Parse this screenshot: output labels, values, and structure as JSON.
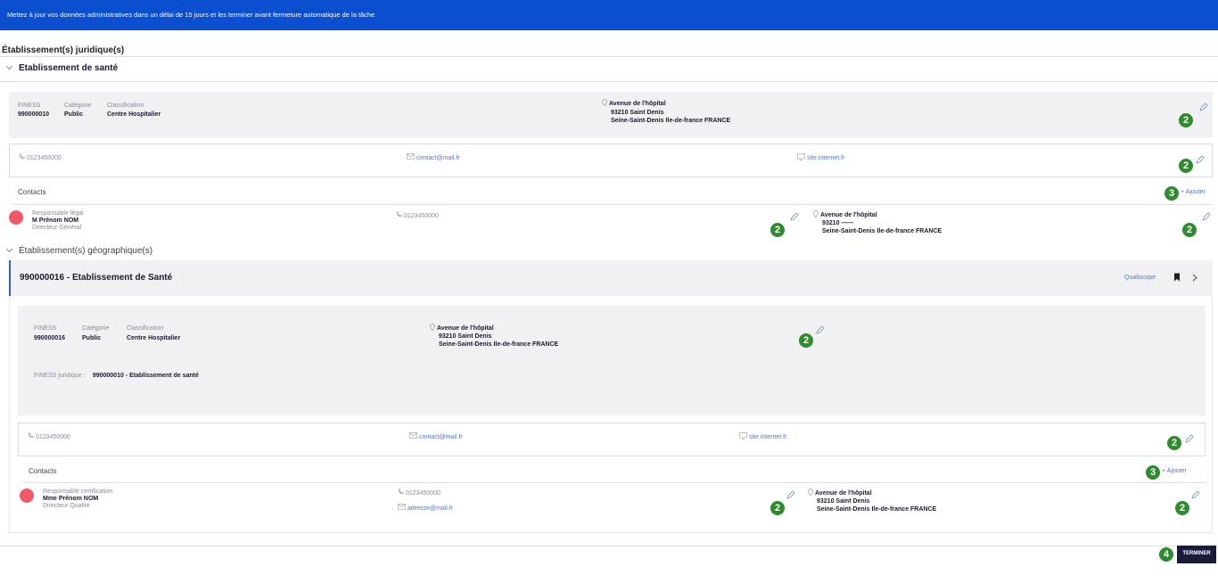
{
  "banner": {
    "text": "Mettez à jour vos données administratives dans un délai de 15 jours et les terminer avant fermeture automatique de la tâche"
  },
  "legal": {
    "title": "Établissement(s) juridique(s)",
    "subtitle": "Etablissement de santé",
    "finess_label": "FINESS",
    "finess": "990000010",
    "categorie_label": "Catégorie",
    "categorie": "Public",
    "classification_label": "Classification",
    "classification": "Centre Hospitalier",
    "addr1": "Avenue de l'hôpital",
    "addr2": "93210  Saint Denis",
    "addr3": "Seine-Saint-Denis  Ile-de-france  FRANCE",
    "phone": "0123450000",
    "email": "contact@mail.fr",
    "website": "site.internet.fr",
    "contacts_label": "Contacts",
    "add_label": "+ Ajouter",
    "contact": {
      "role": "Responsable légal",
      "name": "M  Prénom  NOM",
      "title": "Directeur Général",
      "phone": "0123450000",
      "addr1": "Avenue de l'hôpital",
      "addr2": "93210  ——",
      "addr3": "Seine-Saint-Denis  Ile-de-france  FRANCE"
    }
  },
  "geo": {
    "title": "Établissement(s) géographique(s)",
    "name": "990000016 - Etablissement de Santé",
    "qualiscope": "Qualiscope",
    "finess_label": "FINESS",
    "finess": "990000016",
    "categorie_label": "Catégorie",
    "categorie": "Public",
    "classification_label": "Classification",
    "classification": "Centre Hospitalier",
    "addr1": "Avenue de l'hôpital",
    "addr2": "93210  Saint Denis",
    "addr3": "Seine-Saint-Denis  Ile-de-france  FRANCE",
    "finess_juridique_label": "FINESS juridique :",
    "finess_juridique": "990000010 - Etablissement de santé",
    "phone": "0123450000",
    "email": "contact@mail.fr",
    "website": "site.internet.fr",
    "contacts_label": "Contacts",
    "add_label": "+ Ajouter",
    "contact": {
      "role": "Responsable certification",
      "name": "Mme  Prénom  NOM",
      "title": "Directeur Qualité",
      "phone": "0123450000",
      "email": "adresse@mail.fr",
      "addr1": "Avenue de l'hôpital",
      "addr2": "93210  Saint Denis",
      "addr3": "Seine-Saint-Denis  Ile-de-france  FRANCE"
    }
  },
  "badges": {
    "edit": "2",
    "add": "3",
    "finish": "4"
  },
  "terminer_label": "TERMINER",
  "colors": {
    "banner": "#0b4fd0",
    "badge": "#2e8b2e",
    "avatar": "#f05a68",
    "button": "#1a1a3a",
    "link": "#5574c9"
  }
}
